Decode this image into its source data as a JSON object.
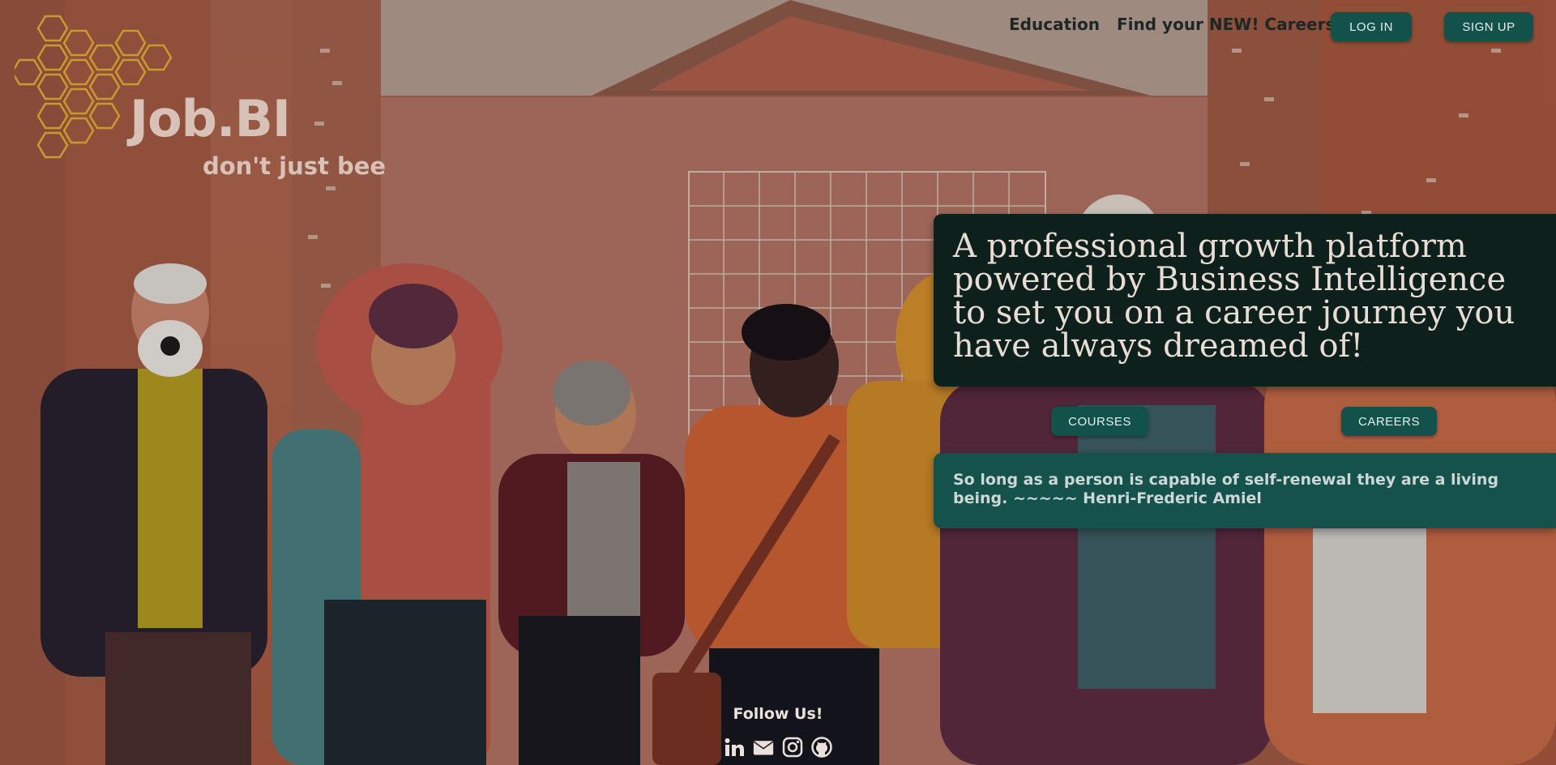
{
  "nav": {
    "education": "Education",
    "careers": "Find your NEW! Careers",
    "login": "LOG IN",
    "signup": "SIGN UP"
  },
  "brand": {
    "name": "Job.BI",
    "tagline": "don't just bee"
  },
  "hero": {
    "headline": "A professional growth platform powered by Business Intelligence to set you on a career journey you have always dreamed of!",
    "courses_button": "COURSES",
    "careers_button": "CAREERS",
    "quote": "So long as a person is capable of self-renewal they are a living being. ~~~~~ Henri-Frederic Amiel"
  },
  "footer": {
    "follow": "Follow Us!",
    "social_icons": [
      "linkedin-icon",
      "email-icon",
      "instagram-icon",
      "github-icon"
    ]
  },
  "colors": {
    "accent": "#12524b",
    "panel": "#0e201c",
    "background": "#b0654c"
  }
}
